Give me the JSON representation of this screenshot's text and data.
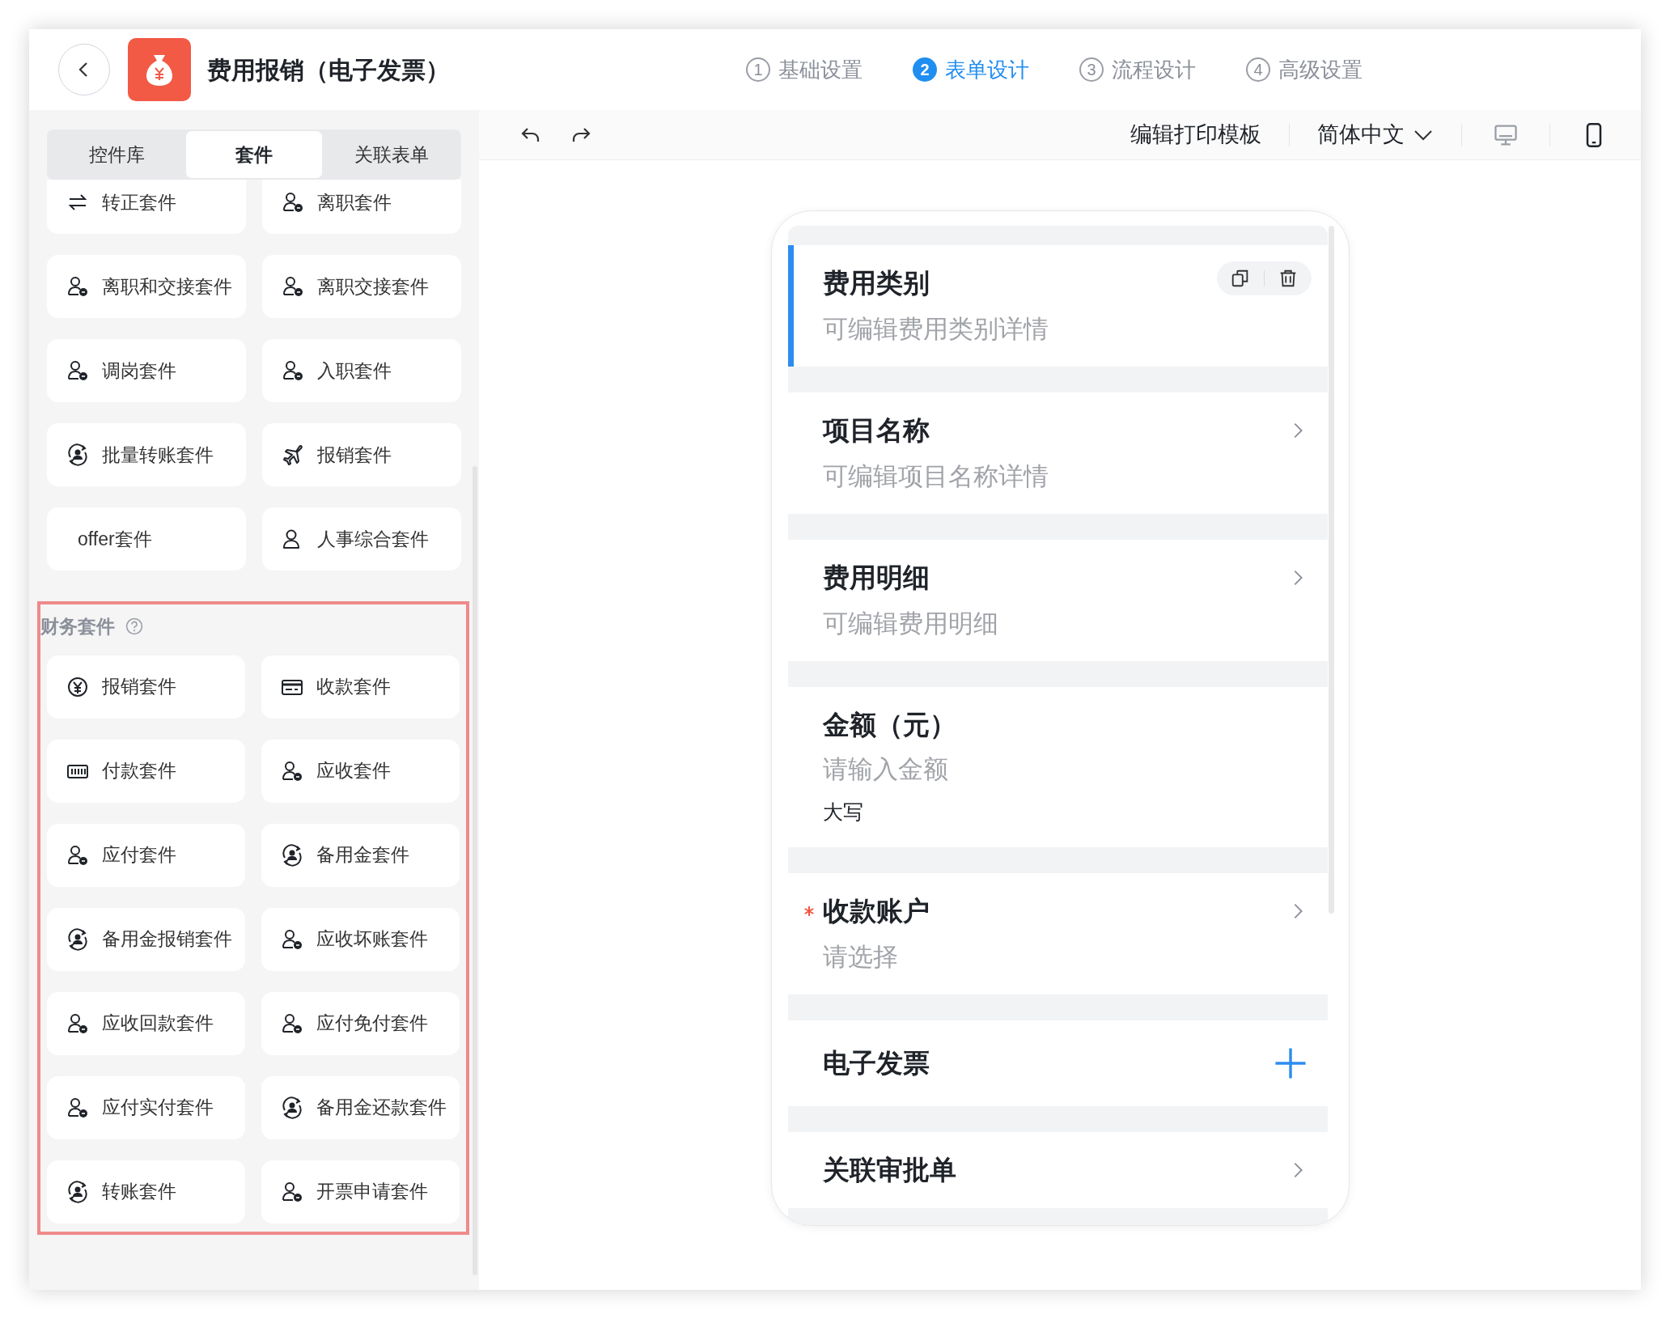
{
  "header": {
    "title": "费用报销（电子发票）"
  },
  "steps": [
    {
      "number": "1",
      "label": "基础设置",
      "selected": false
    },
    {
      "number": "2",
      "label": "表单设计",
      "selected": true
    },
    {
      "number": "3",
      "label": "流程设计",
      "selected": false
    },
    {
      "number": "4",
      "label": "高级设置",
      "selected": false
    }
  ],
  "sidebar": {
    "tabs": [
      {
        "label": "控件库",
        "selected": false
      },
      {
        "label": "套件",
        "selected": true
      },
      {
        "label": "关联表单",
        "selected": false
      }
    ],
    "suites": [
      {
        "kind": "switch",
        "label": "转正套件"
      },
      {
        "kind": "badged",
        "label": "离职套件"
      },
      {
        "kind": "badged",
        "label": "离职和交接套件"
      },
      {
        "kind": "badged",
        "label": "离职交接套件"
      },
      {
        "kind": "badged",
        "label": "调岗套件"
      },
      {
        "kind": "badged",
        "label": "入职套件"
      },
      {
        "kind": "circle",
        "label": "批量转账套件"
      },
      {
        "kind": "plane",
        "label": "报销套件"
      },
      {
        "kind": "none",
        "label": "offer套件"
      },
      {
        "kind": "person",
        "label": "人事综合套件"
      }
    ],
    "finance_suites": {
      "title": "财务套件",
      "highlighted": true,
      "items": [
        {
          "kind": "yen",
          "label": "报销套件"
        },
        {
          "kind": "card",
          "label": "收款套件"
        },
        {
          "kind": "bars",
          "label": "付款套件"
        },
        {
          "kind": "badged",
          "label": "应收套件"
        },
        {
          "kind": "badged",
          "label": "应付套件"
        },
        {
          "kind": "circle",
          "label": "备用金套件"
        },
        {
          "kind": "circle",
          "label": "备用金报销套件"
        },
        {
          "kind": "badged",
          "label": "应收坏账套件"
        },
        {
          "kind": "badged",
          "label": "应收回款套件"
        },
        {
          "kind": "badged",
          "label": "应付免付套件"
        },
        {
          "kind": "badged",
          "label": "应付实付套件"
        },
        {
          "kind": "circle",
          "label": "备用金还款套件"
        },
        {
          "kind": "circle",
          "label": "转账套件"
        },
        {
          "kind": "badged",
          "label": "开票申请套件"
        }
      ]
    }
  },
  "toolbar": {
    "print_template": "编辑打印模板",
    "language": "简体中文",
    "devices": [
      {
        "kind": "desktop",
        "selected": false
      },
      {
        "kind": "mobile",
        "selected": true
      }
    ]
  },
  "form_fields": [
    {
      "kind": "nav",
      "label": "费用类别",
      "hint": "可编辑费用类别详情",
      "required": false,
      "selected": true
    },
    {
      "kind": "nav",
      "label": "项目名称",
      "hint": "可编辑项目名称详情",
      "required": false,
      "selected": false
    },
    {
      "kind": "nav",
      "label": "费用明细",
      "hint": "可编辑费用明细",
      "required": false,
      "selected": false
    },
    {
      "kind": "input",
      "label": "金额（元）",
      "placeholder": "请输入金额",
      "note": "大写",
      "required": false,
      "selected": false
    },
    {
      "kind": "nav",
      "label": "收款账户",
      "hint": "请选择",
      "required": true,
      "selected": false
    },
    {
      "kind": "add",
      "label": "电子发票",
      "required": false,
      "selected": false
    },
    {
      "kind": "nav",
      "label": "关联审批单",
      "required": false,
      "selected": false
    }
  ]
}
